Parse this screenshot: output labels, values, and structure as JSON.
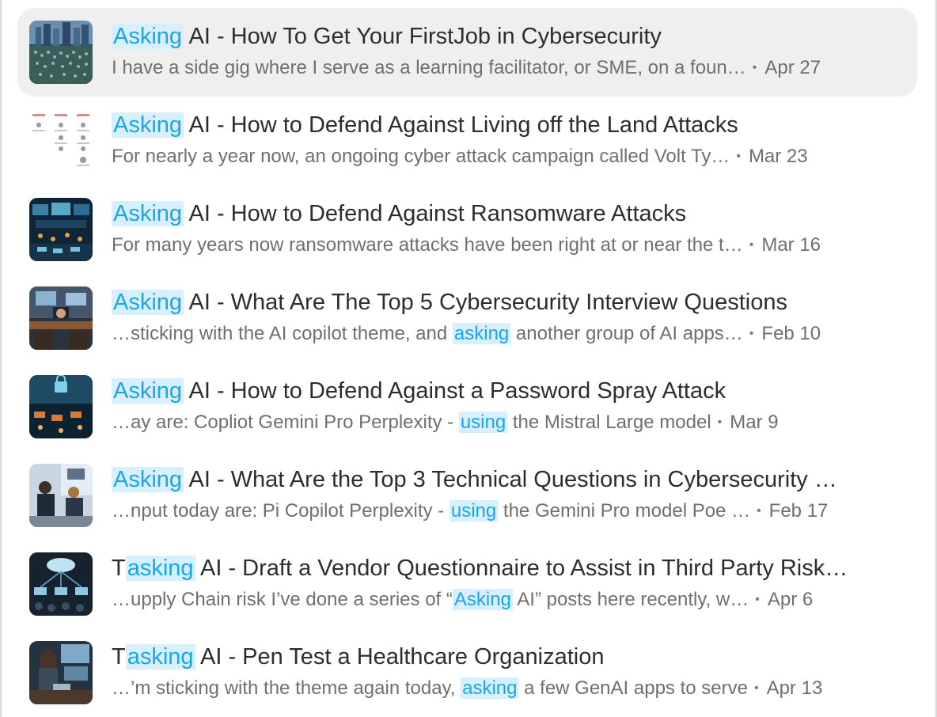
{
  "results": [
    {
      "title": {
        "pre": "",
        "hl": "Asking",
        "post": " AI - How To Get Your FirstJob in Cybersecurity"
      },
      "snippet": {
        "pre": "I have a side gig where I serve as a learning facilitator, or SME, on a foun…",
        "hl": "",
        "post": ""
      },
      "date": "Apr 27",
      "thumb": "city-crowd"
    },
    {
      "title": {
        "pre": "",
        "hl": "Asking",
        "post": " AI - How to Defend Against Living off the Land Attacks"
      },
      "snippet": {
        "pre": "For nearly a year now, an ongoing cyber attack campaign called Volt Ty…",
        "hl": "",
        "post": ""
      },
      "date": "Mar 23",
      "thumb": "diagram"
    },
    {
      "title": {
        "pre": "",
        "hl": "Asking",
        "post": " AI - How to Defend Against Ransomware Attacks"
      },
      "snippet": {
        "pre": "For many years now ransomware attacks have been right at or near the t…",
        "hl": "",
        "post": ""
      },
      "date": "Mar 16",
      "thumb": "control-room"
    },
    {
      "title": {
        "pre": "",
        "hl": "Asking",
        "post": " AI - What Are The Top 5 Cybersecurity Interview Questions"
      },
      "snippet": {
        "pre": "…sticking with the AI copilot theme, and ",
        "hl": "asking",
        "post": " another group of AI apps…"
      },
      "date": "Feb 10",
      "thumb": "office-desk"
    },
    {
      "title": {
        "pre": "",
        "hl": "Asking",
        "post": " AI - How to Defend Against a Password Spray Attack"
      },
      "snippet": {
        "pre": "…ay are: Copliot Gemini Pro Perplexity - ",
        "hl": "using",
        "post": " the Mistral Large model"
      },
      "date": "Mar 9",
      "thumb": "lock-network"
    },
    {
      "title": {
        "pre": "",
        "hl": "Asking",
        "post": " AI - What Are the Top 3 Technical Questions in Cybersecurity …"
      },
      "snippet": {
        "pre": "…nput today are: Pi Copilot Perplexity - ",
        "hl": "using",
        "post": " the Gemini Pro model Poe …"
      },
      "date": "Feb 17",
      "thumb": "interview"
    },
    {
      "title": {
        "pre": "T",
        "hl": "asking",
        "post": " AI - Draft a Vendor Questionnaire to Assist in Third Party Risk…"
      },
      "snippet": {
        "pre": "…upply Chain risk I’ve done a series of “",
        "hl": "Asking",
        "post": " AI” posts here recently, w…"
      },
      "date": "Apr 6",
      "thumb": "cloud-network"
    },
    {
      "title": {
        "pre": "T",
        "hl": "asking",
        "post": " AI - Pen Test a Healthcare Organization"
      },
      "snippet": {
        "pre": "…’m sticking with the theme again today, ",
        "hl": "asking",
        "post": " a few GenAI apps to serve"
      },
      "date": "Apr 13",
      "thumb": "analyst-woman"
    }
  ],
  "colors": {
    "highlight_bg": "#d7efff",
    "highlight_text": "#19a7e6",
    "selected_bg": "#efefef"
  }
}
